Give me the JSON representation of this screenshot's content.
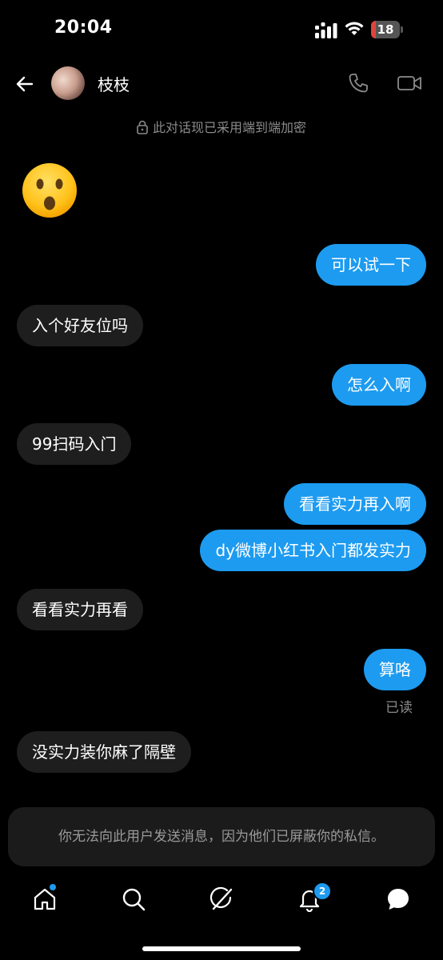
{
  "status_bar": {
    "time": "20:04",
    "battery": "18",
    "battery_level": 0.18
  },
  "header": {
    "back_icon": "arrow-left-icon",
    "contact_name": "枝枝",
    "call_icon": "phone-icon",
    "video_icon": "video-camera-icon"
  },
  "encryption_notice": "此对话现已采用端到端加密",
  "messages": [
    {
      "from": "them",
      "type": "emoji",
      "text": "😮"
    },
    {
      "from": "me",
      "text": "可以试一下"
    },
    {
      "from": "them",
      "text": "入个好友位吗"
    },
    {
      "from": "me",
      "text": "怎么入啊"
    },
    {
      "from": "them",
      "text": "99扫码入门"
    },
    {
      "from": "me",
      "text": "看看实力再入啊"
    },
    {
      "from": "me",
      "text": "dy微博小红书入门都发实力"
    },
    {
      "from": "them",
      "text": "看看实力再看"
    },
    {
      "from": "me",
      "text": "算咯"
    },
    {
      "from": "them",
      "text": "没实力装你麻了隔壁"
    }
  ],
  "read_receipt": "已读",
  "blocked_notice": "你无法向此用户发送消息，因为他们已屏蔽你的私信。",
  "tabbar": {
    "items": [
      "home-icon",
      "search-icon",
      "grok-icon",
      "notifications-bell-icon",
      "messages-icon"
    ],
    "notification_count": "2"
  },
  "colors": {
    "accent": "#1d9bf0",
    "incoming_bubble": "#1e1e1e",
    "background": "#000000"
  }
}
